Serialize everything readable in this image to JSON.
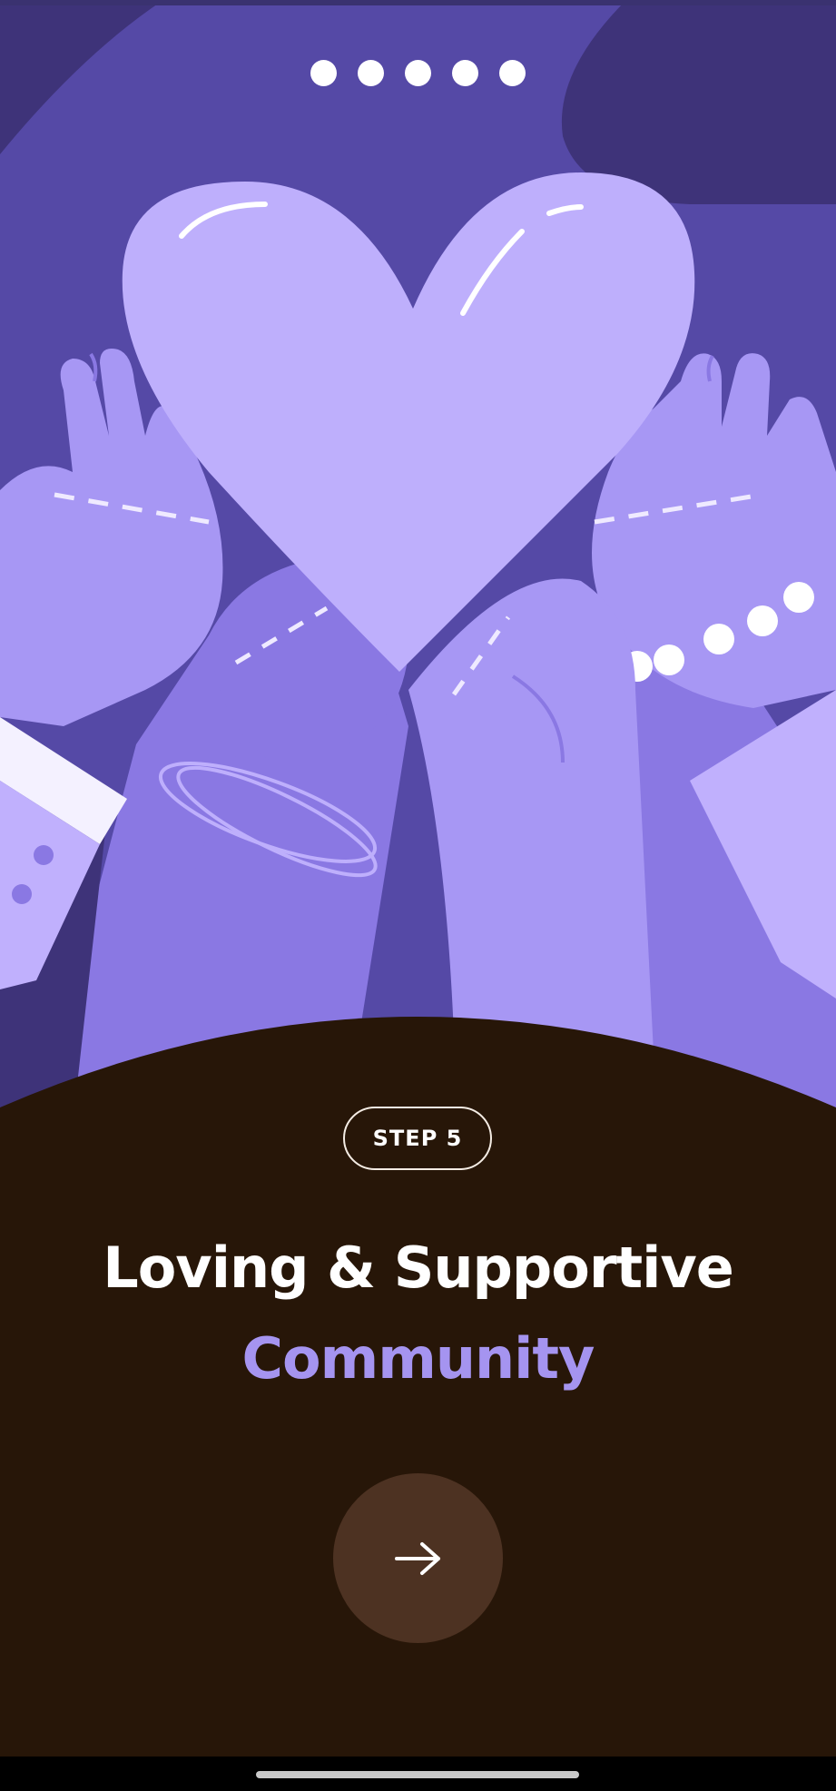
{
  "onboarding": {
    "pager": {
      "total": 5,
      "current": 5
    },
    "step_label": "STEP 5",
    "title_line_1": "Loving & Supportive",
    "title_line_2": "Community",
    "next_button_icon": "arrow-right-icon"
  },
  "colors": {
    "hero_background": "#5549a6",
    "heart": "#beaffc",
    "title_accent": "#a594f0",
    "panel_background": "#271608",
    "next_button": "#4d3222"
  }
}
